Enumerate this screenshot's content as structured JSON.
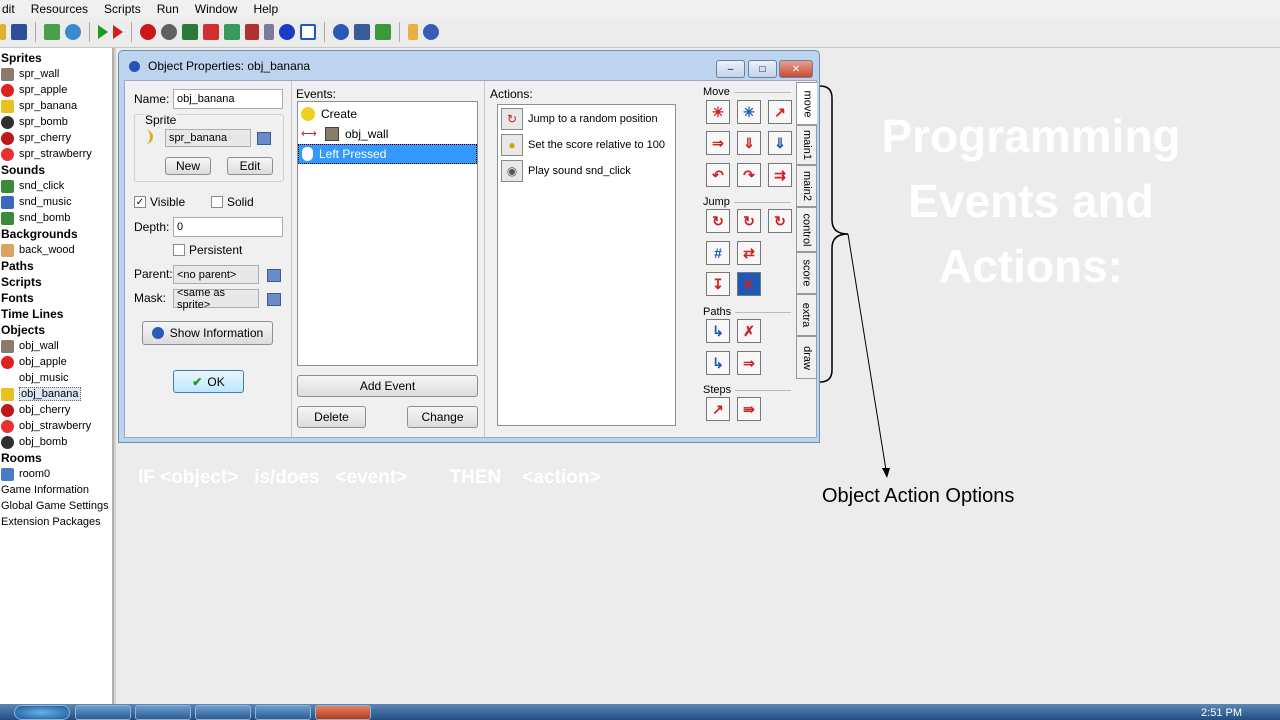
{
  "menubar": {
    "items": [
      "dit",
      "Resources",
      "Scripts",
      "Run",
      "Window",
      "Help"
    ]
  },
  "tree": {
    "groups": [
      {
        "name": "Sprites",
        "items": [
          {
            "label": "spr_wall",
            "icon": "wall-icon",
            "color": "#8b7b6b"
          },
          {
            "label": "spr_apple",
            "icon": "apple-icon",
            "color": "#e02020"
          },
          {
            "label": "spr_banana",
            "icon": "banana-icon",
            "color": "#e8c020"
          },
          {
            "label": "spr_bomb",
            "icon": "bomb-icon",
            "color": "#303030"
          },
          {
            "label": "spr_cherry",
            "icon": "cherry-icon",
            "color": "#c01818"
          },
          {
            "label": "spr_strawberry",
            "icon": "strawberry-icon",
            "color": "#e83030"
          }
        ]
      },
      {
        "name": "Sounds",
        "items": [
          {
            "label": "snd_click",
            "icon": "sound-icon",
            "color": "#3a8a3a"
          },
          {
            "label": "snd_music",
            "icon": "music-icon",
            "color": "#3a6ab8"
          },
          {
            "label": "snd_bomb",
            "icon": "sound-icon",
            "color": "#3a8a3a"
          }
        ]
      },
      {
        "name": "Backgrounds",
        "items": [
          {
            "label": "back_wood",
            "icon": "background-icon",
            "color": "#d9a55e"
          }
        ]
      },
      {
        "name": "Paths",
        "items": []
      },
      {
        "name": "Scripts",
        "items": []
      },
      {
        "name": "Fonts",
        "items": []
      },
      {
        "name": "Time Lines",
        "items": []
      },
      {
        "name": "Objects",
        "items": [
          {
            "label": "obj_wall",
            "icon": "wall-icon",
            "color": "#8b7b6b"
          },
          {
            "label": "obj_apple",
            "icon": "apple-icon",
            "color": "#e02020"
          },
          {
            "label": "obj_music",
            "icon": "blank-icon",
            "color": "#ffffff"
          },
          {
            "label": "obj_banana",
            "icon": "banana-icon",
            "color": "#e8c020",
            "selected": true
          },
          {
            "label": "obj_cherry",
            "icon": "cherry-icon",
            "color": "#c01818"
          },
          {
            "label": "obj_strawberry",
            "icon": "strawberry-icon",
            "color": "#e83030"
          },
          {
            "label": "obj_bomb",
            "icon": "bomb-icon",
            "color": "#303030"
          }
        ]
      },
      {
        "name": "Rooms",
        "items": [
          {
            "label": "room0",
            "icon": "room-icon",
            "color": "#4a7ac8"
          }
        ]
      }
    ],
    "extras": [
      "Game Information",
      "Global Game Settings",
      "Extension Packages"
    ]
  },
  "dialog": {
    "title": "Object Properties: obj_banana",
    "name_label": "Name:",
    "name_value": "obj_banana",
    "sprite_group": "Sprite",
    "sprite_value": "spr_banana",
    "new_label": "New",
    "edit_label": "Edit",
    "visible_label": "Visible",
    "visible_checked": true,
    "solid_label": "Solid",
    "solid_checked": false,
    "depth_label": "Depth:",
    "depth_value": "0",
    "persistent_label": "Persistent",
    "persistent_checked": false,
    "parent_label": "Parent:",
    "parent_value": "<no parent>",
    "mask_label": "Mask:",
    "mask_value": "<same as sprite>",
    "show_info_label": "Show Information",
    "ok_label": "OK",
    "events_label": "Events:",
    "events": [
      {
        "label": "Create",
        "icon": "lightbulb-icon"
      },
      {
        "label": "obj_wall",
        "icon": "collision-icon"
      },
      {
        "label": "Left Pressed",
        "icon": "mouse-icon",
        "selected": true
      }
    ],
    "add_event_label": "Add Event",
    "delete_label": "Delete",
    "change_label": "Change",
    "actions_label": "Actions:",
    "actions": [
      {
        "label": "Jump to a random position",
        "icon": "jump-random-icon"
      },
      {
        "label": "Set the score relative to 100",
        "icon": "score-icon"
      },
      {
        "label": "Play sound snd_click",
        "icon": "sound-icon"
      }
    ],
    "palette": {
      "sections": {
        "move": "Move",
        "jump": "Jump",
        "paths": "Paths",
        "steps": "Steps"
      },
      "tabs": [
        "move",
        "main1",
        "main2",
        "control",
        "score",
        "extra",
        "draw"
      ]
    }
  },
  "slide": {
    "title_lines": [
      "Programming",
      "Events and",
      "Actions:"
    ],
    "if_then": "IF <object>   is/does   <event>        THEN    <action>",
    "caption": "Object Action Options"
  },
  "taskbar": {
    "time": "2:51 PM"
  }
}
